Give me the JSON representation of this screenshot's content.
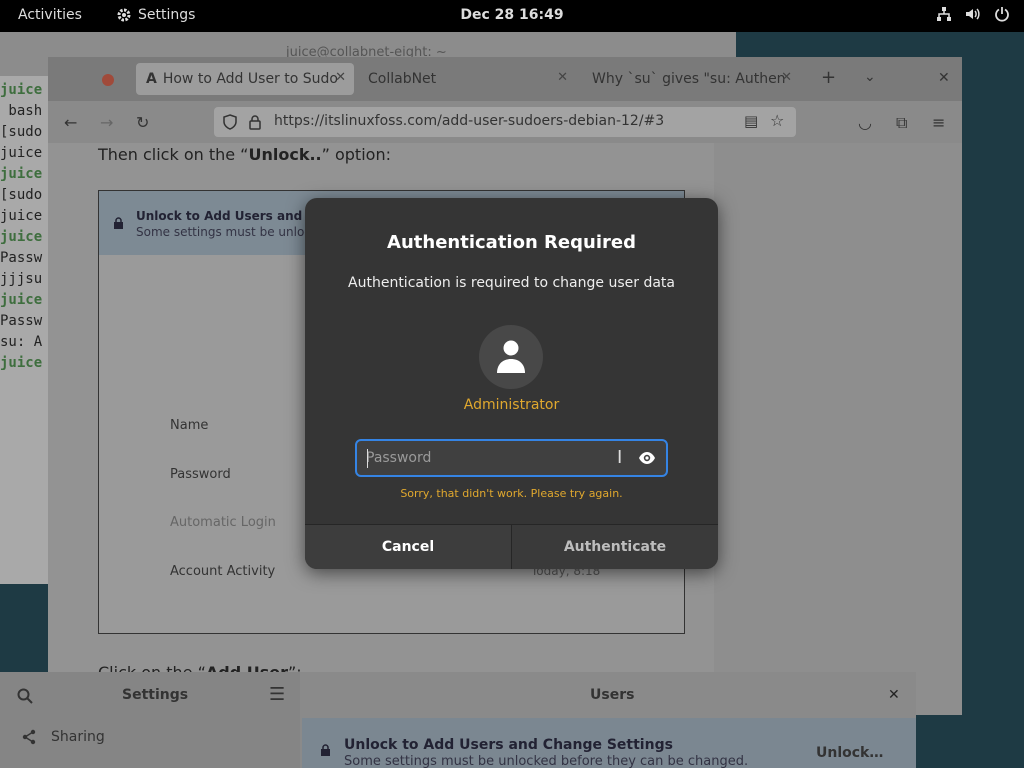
{
  "topbar": {
    "activities": "Activities",
    "app_name": "Settings",
    "clock": "Dec 28  16:49"
  },
  "terminal": {
    "title": "juice@collabnet-eight: ~",
    "lines": [
      "juice",
      " bash",
      "[sudo",
      "juice",
      "juice",
      "[sudo",
      "juice",
      "juice",
      "Passw",
      "jjjsu",
      "juice",
      "Passw",
      "su: A",
      "juice"
    ]
  },
  "browser": {
    "tabs": [
      {
        "label": "How to Add User to Sudo"
      },
      {
        "label": "CollabNet"
      },
      {
        "label": "Why `su` gives \"su: Authen"
      }
    ],
    "new_tab": "+",
    "url": "https://itslinuxfoss.com/add-user-sudoers-debian-12/#3",
    "page": {
      "instruction_prefix": "Then click on the “",
      "instruction_bold": "Unlock..",
      "instruction_suffix": "” option:",
      "instruction2_prefix": "Click on the “",
      "instruction2_bold": "Add User",
      "instruction2_suffix": "”:",
      "figure": {
        "banner_title": "Unlock to Add Users and Cha",
        "banner_sub": "Some settings must be unlock",
        "rows": [
          "Name",
          "Password",
          "Automatic Login",
          "Account Activity"
        ],
        "today": "Today,     8:18"
      }
    }
  },
  "settings": {
    "sidebar_title": "Settings",
    "sharing": "Sharing",
    "panel_title": "Users",
    "banner_title": "Unlock to Add Users and Change Settings",
    "banner_sub": "Some settings must be unlocked before they can be changed.",
    "unlock_button": "Unlock…"
  },
  "dialog": {
    "title": "Authentication Required",
    "message": "Authentication is required to change user data",
    "user": "Administrator",
    "password_placeholder": "Password",
    "error": "Sorry, that didn't work. Please try again.",
    "cancel": "Cancel",
    "authenticate": "Authenticate"
  },
  "colors": {
    "accent": "#3584e4",
    "warning": "#e0a82e",
    "dialog_bg": "#353535"
  },
  "icons": [
    "gear-icon",
    "network-icon",
    "volume-icon",
    "power-icon",
    "user-avatar-icon",
    "eye-icon",
    "lock-icon",
    "share-icon",
    "search-icon",
    "menu-icon",
    "close-icon"
  ]
}
